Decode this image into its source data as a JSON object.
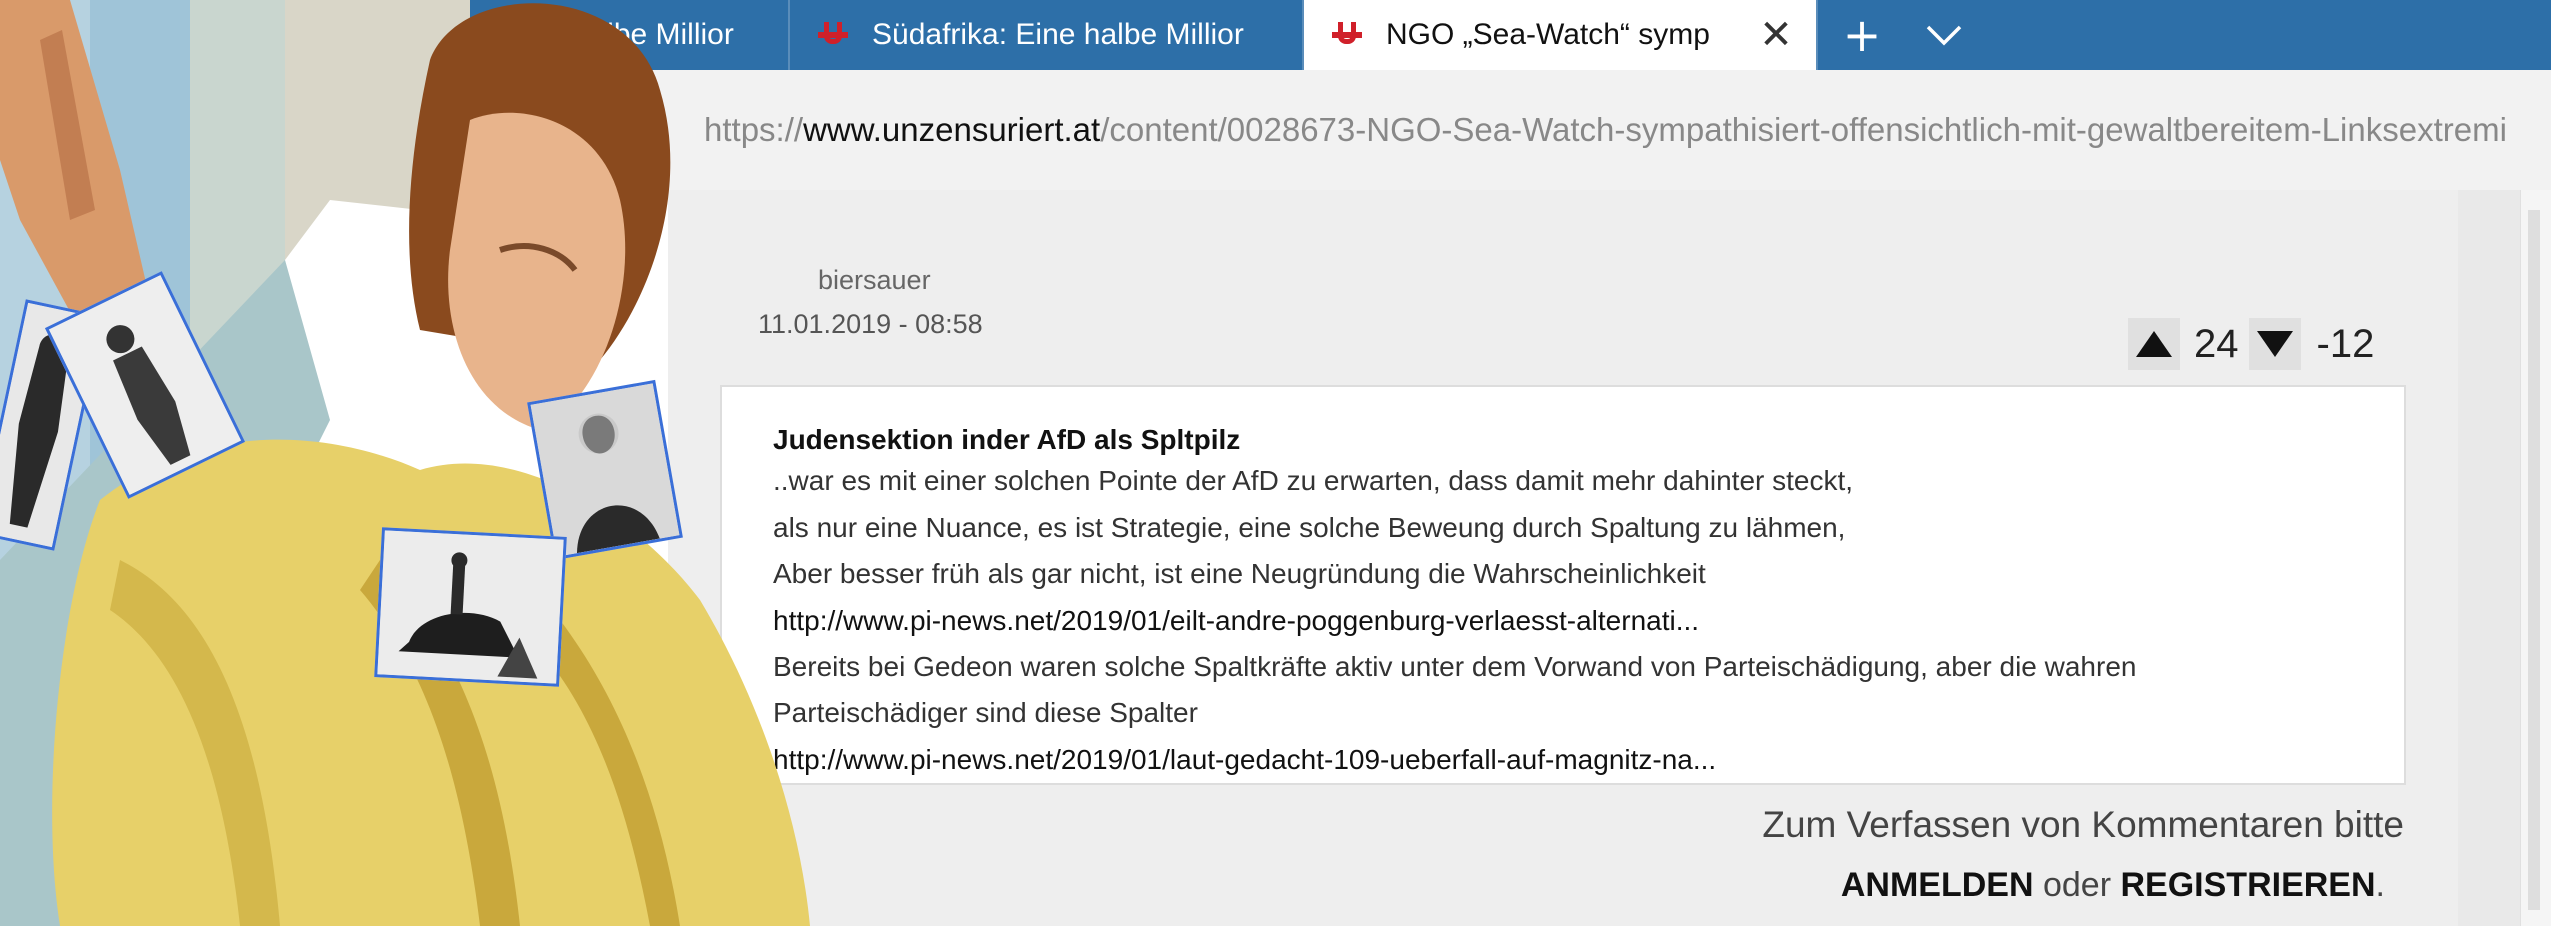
{
  "browser": {
    "tabs": [
      {
        "title": "Südafrika: Eine halbe Millior",
        "active": false
      },
      {
        "title": "Südafrika: Eine halbe Millior",
        "active": false
      },
      {
        "title": "NGO „Sea-Watch“ symp",
        "active": true
      }
    ],
    "new_tab_icon": "plus-icon",
    "tab_list_icon": "chevron-down-icon",
    "url_prefix": "https://",
    "url_host": "www.unzensuriert.at",
    "url_path": "/content/0028673-NGO-Sea-Watch-sympathisiert-offensichtlich-mit-gewaltbereitem-Linksextremi"
  },
  "comment": {
    "author": "biersauer",
    "date": "11.01.2019 - 08:58",
    "votes_up": "24",
    "votes_down": "-12",
    "title": "Judensektion inder AfD als Spltpilz",
    "lines": [
      "..war es mit einer solchen Pointe der AfD zu erwarten, dass damit mehr dahinter steckt,",
      "als nur eine Nuance, es ist Strategie, eine solche Beweung durch Spaltung zu lähmen,",
      "Aber besser früh als gar nicht, ist eine Neugründung die Wahrscheinlichkeit",
      "http://www.pi-news.net/2019/01/eilt-andre-poggenburg-verlaesst-alternati...",
      "Bereits bei Gedeon waren solche Spaltkräfte aktiv unter dem Vorwand von Parteischädigung, aber die wahren",
      "Parteischädiger sind diese Spalter",
      "http://www.pi-news.net/2019/01/laut-gedacht-109-ueberfall-auf-magnitz-na..."
    ]
  },
  "login": {
    "prompt": "Zum Verfassen von Kommentaren bitte",
    "login_label": "ANMELDEN",
    "or_label": "oder",
    "register_label": "REGISTRIEREN",
    "period": "."
  },
  "colors": {
    "tabbar": "#2d6fa8",
    "favicon_red": "#d0202a",
    "selection_blue": "#3a6fd8"
  }
}
